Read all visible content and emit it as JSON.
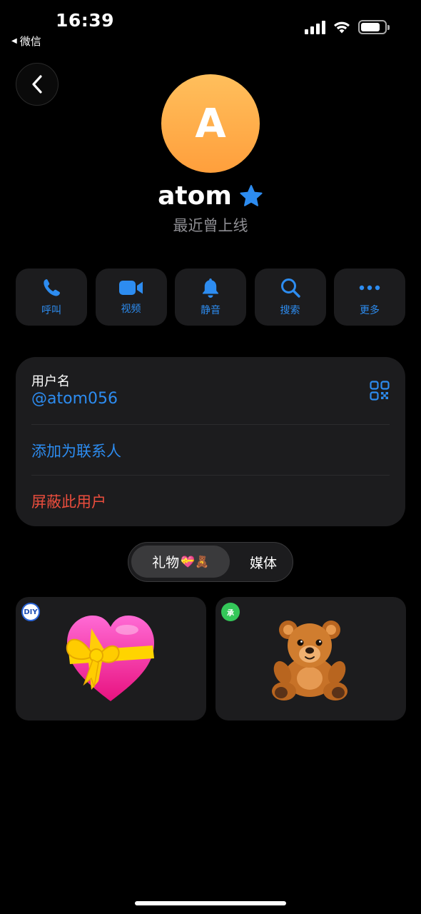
{
  "status_bar": {
    "time": "16:39",
    "back_app_label": "微信",
    "back_app_icon": "triangle-left-icon",
    "battery_level": 0.8
  },
  "profile": {
    "avatar_letter": "A",
    "avatar_color": "#ffaa48",
    "name": "atom",
    "verified_icon": "star-badge-icon",
    "status": "最近曾上线"
  },
  "actions": [
    {
      "label": "呼叫",
      "icon": "phone-icon"
    },
    {
      "label": "视频",
      "icon": "video-camera-icon"
    },
    {
      "label": "静音",
      "icon": "bell-icon"
    },
    {
      "label": "搜索",
      "icon": "search-icon"
    },
    {
      "label": "更多",
      "icon": "more-dots-icon"
    }
  ],
  "info": {
    "username_label": "用户名",
    "username_value": "@atom056",
    "add_contact": "添加为联系人",
    "block_user": "屏蔽此用户"
  },
  "tabs": {
    "gifts_label": "礼物",
    "gifts_emoji": "💝🧸",
    "media_label": "媒体"
  },
  "gifts": [
    {
      "item": "heart-with-ribbon",
      "badge": "DIY"
    },
    {
      "item": "teddy-bear",
      "badge": "承"
    }
  ],
  "colors": {
    "accent": "#2d8cf0",
    "danger": "#eb4d3d",
    "card": "#1c1c1e"
  }
}
